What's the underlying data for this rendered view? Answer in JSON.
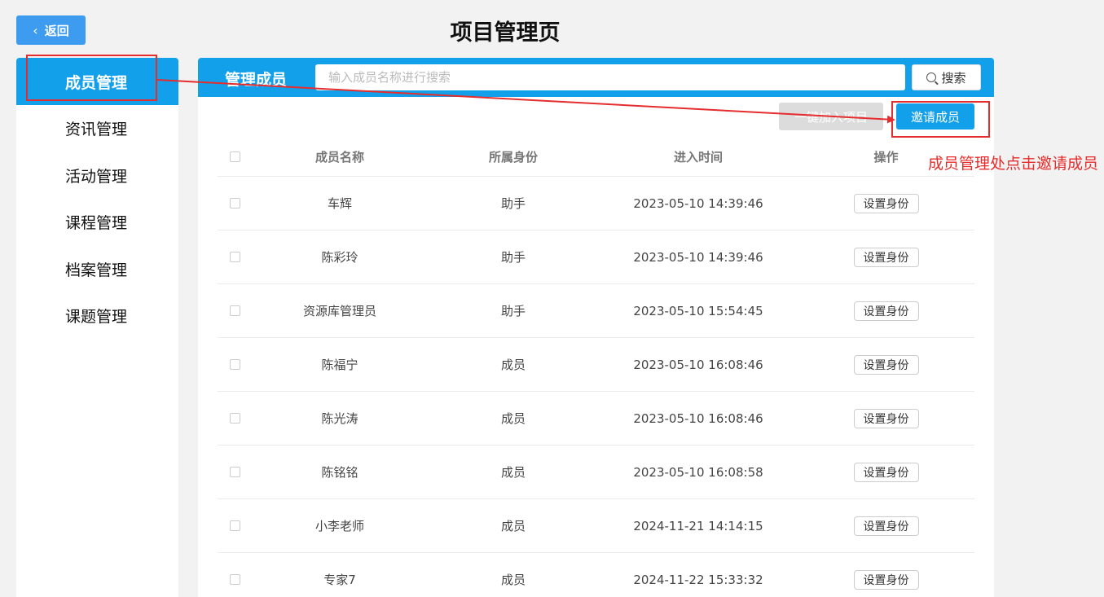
{
  "header": {
    "back_label": "返回",
    "page_title": "项目管理页"
  },
  "sidebar": {
    "items": [
      {
        "label": "成员管理",
        "active": true
      },
      {
        "label": "资讯管理"
      },
      {
        "label": "活动管理"
      },
      {
        "label": "课程管理"
      },
      {
        "label": "档案管理"
      },
      {
        "label": "课题管理"
      }
    ]
  },
  "main": {
    "title": "管理成员",
    "search": {
      "placeholder": "输入成员名称进行搜索",
      "button_label": "搜索"
    },
    "actions": {
      "join_label": "一键加入项目",
      "invite_label": "邀请成员"
    },
    "table": {
      "columns": [
        "成员名称",
        "所属身份",
        "进入时间",
        "操作"
      ],
      "rows": [
        {
          "name": "车辉",
          "role": "助手",
          "time": "2023-05-10 14:39:46",
          "op": "设置身份"
        },
        {
          "name": "陈彩玲",
          "role": "助手",
          "time": "2023-05-10 14:39:46",
          "op": "设置身份"
        },
        {
          "name": "资源库管理员",
          "role": "助手",
          "time": "2023-05-10 15:54:45",
          "op": "设置身份"
        },
        {
          "name": "陈福宁",
          "role": "成员",
          "time": "2023-05-10 16:08:46",
          "op": "设置身份"
        },
        {
          "name": "陈光涛",
          "role": "成员",
          "time": "2023-05-10 16:08:46",
          "op": "设置身份"
        },
        {
          "name": "陈铭铭",
          "role": "成员",
          "time": "2023-05-10 16:08:58",
          "op": "设置身份"
        },
        {
          "name": "小李老师",
          "role": "成员",
          "time": "2024-11-21 14:14:15",
          "op": "设置身份"
        },
        {
          "name": "专家7",
          "role": "成员",
          "time": "2024-11-22 15:33:32",
          "op": "设置身份"
        }
      ]
    }
  },
  "annotation": {
    "text": "成员管理处点击邀请成员",
    "color": "#e52d2d"
  },
  "colors": {
    "accent": "#13a0ea",
    "back_button": "#3d9bf0"
  }
}
